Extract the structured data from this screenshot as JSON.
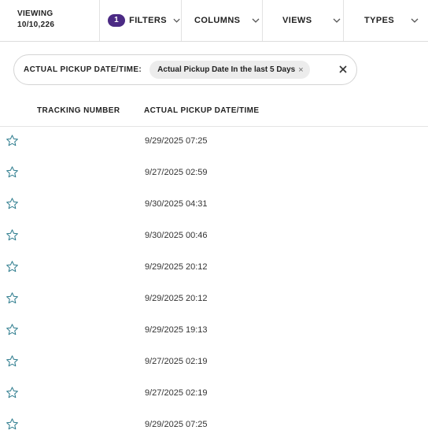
{
  "toolbar": {
    "viewing_label": "VIEWING",
    "viewing_count": "10/10,226",
    "filters_count": "1",
    "filters_label": "FILTERS",
    "columns_label": "COLUMNS",
    "views_label": "VIEWS",
    "types_label": "TYPES"
  },
  "filter": {
    "label": "ACTUAL PICKUP DATE/TIME:",
    "chip_text": "Actual Pickup Date In the last 5 Days",
    "chip_remove": "×"
  },
  "table": {
    "columns": [
      "TRACKING NUMBER",
      "ACTUAL PICKUP DATE/TIME"
    ],
    "rows": [
      {
        "pickup": "9/29/2025 07:25"
      },
      {
        "pickup": "9/27/2025 02:59"
      },
      {
        "pickup": "9/30/2025 04:31"
      },
      {
        "pickup": "9/30/2025 00:46"
      },
      {
        "pickup": "9/29/2025 20:12"
      },
      {
        "pickup": "9/29/2025 20:12"
      },
      {
        "pickup": "9/29/2025 19:13"
      },
      {
        "pickup": "9/27/2025 02:19"
      },
      {
        "pickup": "9/27/2025 02:19"
      },
      {
        "pickup": "9/29/2025 07:25"
      }
    ]
  },
  "colors": {
    "badge": "#4b2a84",
    "star": "#2a7a8c"
  },
  "icons": {
    "dropdown": "chevron-down-icon",
    "favorite": "star-outline-icon",
    "clear": "close-icon"
  }
}
